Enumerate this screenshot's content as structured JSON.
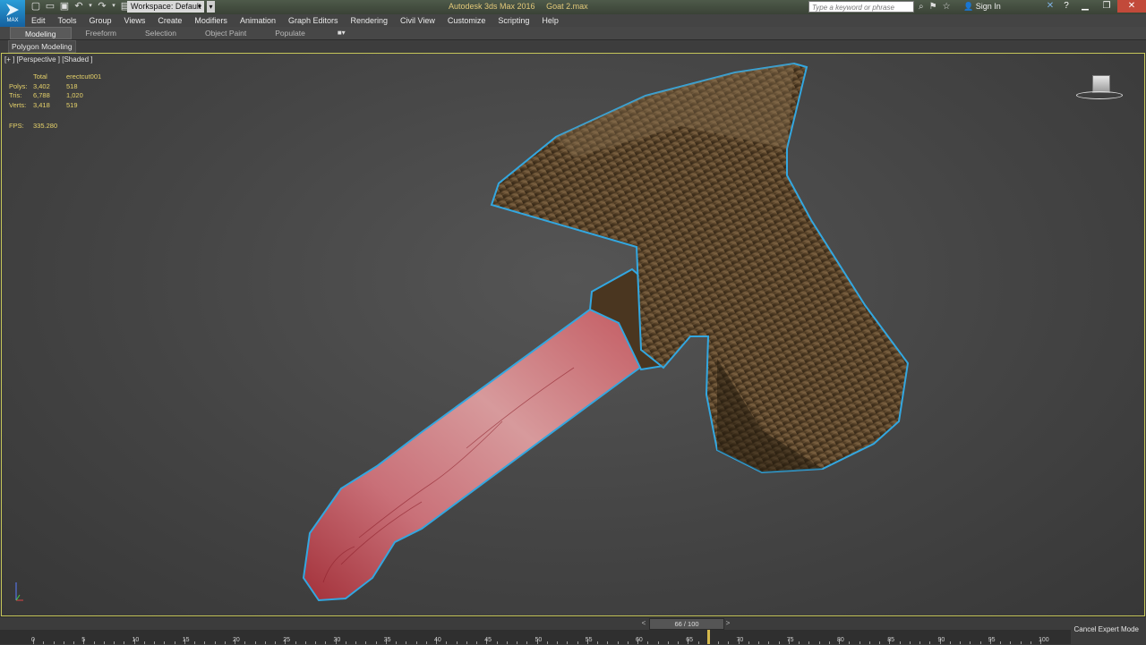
{
  "app": {
    "title": "Autodesk 3ds Max 2016",
    "file": "Goat 2.max",
    "logo_text": "MAX"
  },
  "quickaccess": {
    "workspace_label": "Workspace: Default",
    "icons": [
      "new-file-icon",
      "open-file-icon",
      "save-icon",
      "undo-icon",
      "undo-dropdown-icon",
      "redo-icon",
      "redo-dropdown-icon",
      "project-folder-icon"
    ]
  },
  "search": {
    "placeholder": "Type a keyword or phrase"
  },
  "account": {
    "signin_label": "Sign In"
  },
  "menu": [
    "Edit",
    "Tools",
    "Group",
    "Views",
    "Create",
    "Modifiers",
    "Animation",
    "Graph Editors",
    "Rendering",
    "Civil View",
    "Customize",
    "Scripting",
    "Help"
  ],
  "ribbon": {
    "tabs": [
      "Modeling",
      "Freeform",
      "Selection",
      "Object Paint",
      "Populate"
    ],
    "active_tab": "Modeling",
    "panel_label": "Polygon Modeling"
  },
  "viewport": {
    "label": "[+ ] [Perspective ] [Shaded ]",
    "stats": {
      "header": [
        "",
        "Total",
        "erectcut001"
      ],
      "rows": [
        [
          "Polys:",
          "3,402",
          "518"
        ],
        [
          "Tris:",
          "6,788",
          "1,020"
        ],
        [
          "Verts:",
          "3,418",
          "519"
        ]
      ],
      "fps_label": "FPS:",
      "fps_value": "335.280"
    },
    "colors": {
      "stat_text": "#e6d26a",
      "outline": "#33a7e0",
      "fur": "#5a4325",
      "flesh": "#c05a60"
    }
  },
  "timeline": {
    "frame_display": "66 / 100",
    "current_frame": 66,
    "total_frames": 100,
    "tick_labels": [
      "0",
      "5",
      "10",
      "15",
      "20",
      "25",
      "30",
      "35",
      "40",
      "45",
      "50",
      "55",
      "60",
      "65",
      "70",
      "75",
      "80",
      "85",
      "90",
      "95",
      "100"
    ]
  },
  "status": {
    "expert_mode_label": "Cancel Expert Mode"
  }
}
